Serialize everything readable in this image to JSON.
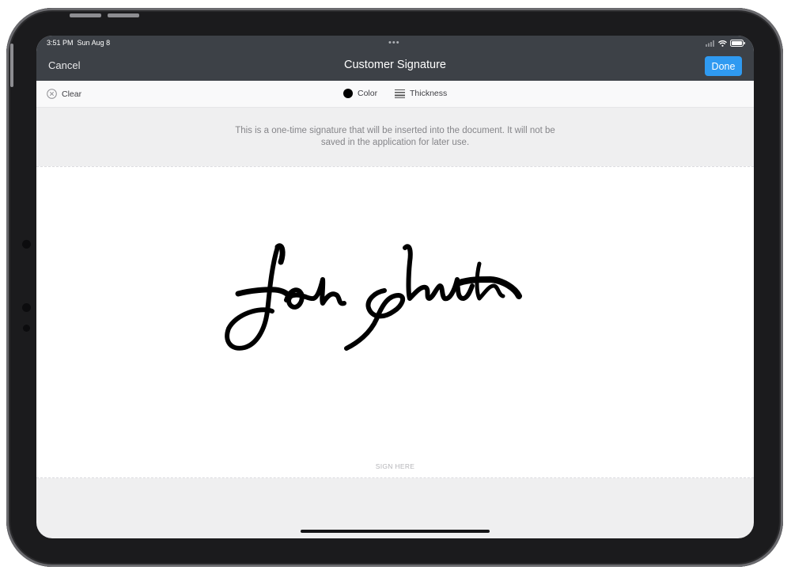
{
  "status_bar": {
    "time": "3:51 PM",
    "date": "Sun Aug 8",
    "dots": "•••",
    "icons": [
      "cellular-icon",
      "wifi-icon",
      "battery-icon"
    ]
  },
  "navbar": {
    "cancel_label": "Cancel",
    "title": "Customer Signature",
    "done_label": "Done"
  },
  "toolbar": {
    "clear_label": "Clear",
    "color_label": "Color",
    "thickness_label": "Thickness",
    "current_color": "#000000"
  },
  "notice": {
    "line1": "This is a one-time signature that will be inserted into the document. It will not be",
    "line2": "saved in the application for later use."
  },
  "signature_pad": {
    "placeholder": "SIGN HERE",
    "ink_color": "#000000"
  },
  "colors": {
    "navbar": "#3d4147",
    "accent": "#2f9af1",
    "screen_bg": "#efeff0",
    "pad_bg": "#ffffff"
  }
}
